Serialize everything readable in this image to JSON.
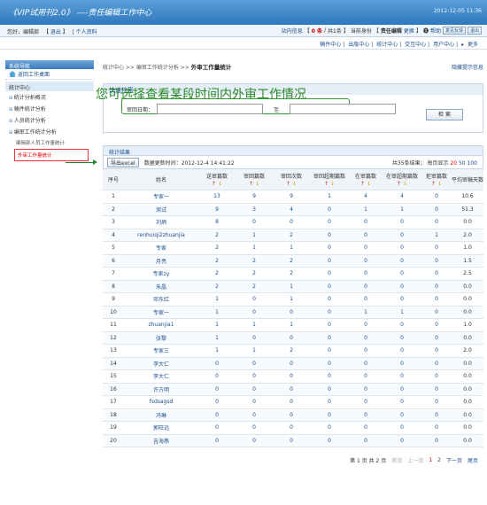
{
  "header": {
    "title": "《VIP试用刊2.0》 ----责任编辑工作中心",
    "date": "2012-12-05 11:36"
  },
  "userbar": {
    "greeting": "您好，编辑部",
    "logout": "退出",
    "profile": "个人资料",
    "site_msg": "站内信息",
    "msg_count": "0 条",
    "msg_total": "共1条",
    "identity_label": "当前身份",
    "identity": "责任编辑",
    "change": "更换",
    "help": "帮助",
    "feedback": "意见反馈",
    "quit": "退出"
  },
  "menu": [
    "稿件中心",
    "出版中心",
    "统计中心",
    "交互中心",
    "用户中心",
    "更多"
  ],
  "sidebar": {
    "nav_title": "系统导航",
    "back": "返回工作桌面",
    "section": "统计中心",
    "items": [
      "统计分析概况",
      "稿件统计分析",
      "人员统计分析",
      "编审工作统计分析"
    ],
    "sub": "编辑部人员工作量统计",
    "active": "外审工作量统计"
  },
  "breadcrumb": {
    "path": "统计中心 >> 编审工作统计分析 >> ",
    "current": "外审工作量统计",
    "hide": "隐藏提示信息"
  },
  "search": {
    "title": "快速检索",
    "date_label": "审回日期：",
    "to_label": "至",
    "button": "检 索",
    "note": "您可选择查看某段时间内外审工作情况"
  },
  "result": {
    "title": "统计结果",
    "export": "导出excel",
    "updated": "数据更新时间：2012-12-4 14:41:22",
    "total": "共35条结果；",
    "per_page": "每页显示",
    "sizes": [
      "20",
      "50",
      "100"
    ]
  },
  "table": {
    "headers": [
      "序号",
      "姓名",
      "送审篇数",
      "审回篇数",
      "审回次数",
      "审回超期篇数",
      "在审篇数",
      "在审超期篇数",
      "拒审篇数",
      "平均审稿天数"
    ],
    "sort_up": "↑",
    "sort_down": "↓",
    "rows": [
      [
        "1",
        "专家一",
        "13",
        "9",
        "9",
        "1",
        "4",
        "4",
        "0",
        "10.6"
      ],
      [
        "2",
        "测试",
        "9",
        "3",
        "4",
        "0",
        "1",
        "1",
        "0",
        "51.3"
      ],
      [
        "3",
        "刘炳",
        "8",
        "0",
        "0",
        "0",
        "0",
        "0",
        "0",
        "0.0"
      ],
      [
        "4",
        "renhuiqi2zhuanjia",
        "2",
        "1",
        "2",
        "0",
        "0",
        "0",
        "1",
        "2.0"
      ],
      [
        "5",
        "专家",
        "2",
        "1",
        "1",
        "0",
        "0",
        "0",
        "0",
        "1.0"
      ],
      [
        "6",
        "月亮",
        "2",
        "2",
        "2",
        "0",
        "0",
        "0",
        "0",
        "1.5"
      ],
      [
        "7",
        "专家zy",
        "2",
        "2",
        "2",
        "0",
        "0",
        "0",
        "0",
        "2.5"
      ],
      [
        "8",
        "朱晶",
        "2",
        "2",
        "1",
        "0",
        "0",
        "0",
        "0",
        "0.0"
      ],
      [
        "9",
        "邓东红",
        "1",
        "0",
        "1",
        "0",
        "0",
        "0",
        "0",
        "0.0"
      ],
      [
        "10",
        "专家一",
        "1",
        "0",
        "0",
        "0",
        "1",
        "1",
        "0",
        "0.0"
      ],
      [
        "11",
        "zhuanjia1",
        "1",
        "1",
        "1",
        "0",
        "0",
        "0",
        "0",
        "1.0"
      ],
      [
        "12",
        "张黎",
        "1",
        "0",
        "0",
        "0",
        "0",
        "0",
        "0",
        "0.0"
      ],
      [
        "13",
        "专家三",
        "1",
        "1",
        "2",
        "0",
        "0",
        "0",
        "0",
        "2.0"
      ],
      [
        "14",
        "李大仁",
        "0",
        "0",
        "0",
        "0",
        "0",
        "0",
        "0",
        "0.0"
      ],
      [
        "15",
        "李大仁",
        "0",
        "0",
        "0",
        "0",
        "0",
        "0",
        "0",
        "0.0"
      ],
      [
        "16",
        "许方明",
        "0",
        "0",
        "0",
        "0",
        "0",
        "0",
        "0",
        "0.0"
      ],
      [
        "17",
        "fsdsagsd",
        "0",
        "0",
        "0",
        "0",
        "0",
        "0",
        "0",
        "0.0"
      ],
      [
        "18",
        "冯琳",
        "0",
        "0",
        "0",
        "0",
        "0",
        "0",
        "0",
        "0.0"
      ],
      [
        "19",
        "郭旺远",
        "0",
        "0",
        "0",
        "0",
        "0",
        "0",
        "0",
        "0.0"
      ],
      [
        "20",
        "吉海燕",
        "0",
        "0",
        "0",
        "0",
        "0",
        "0",
        "0",
        "0.0"
      ]
    ]
  },
  "pager": {
    "page_info": "第 1 页 共 2 页",
    "first": "首页",
    "prev": "上一页",
    "p1": "1",
    "p2": "2",
    "next": "下一页",
    "last": "尾页"
  }
}
